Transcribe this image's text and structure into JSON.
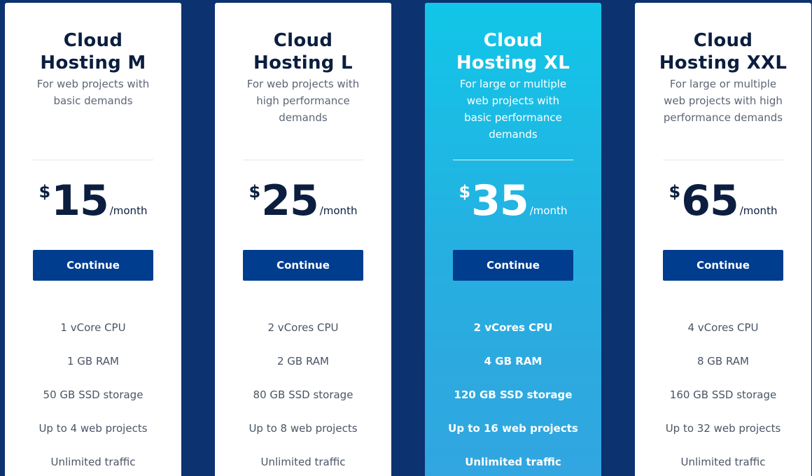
{
  "plans": [
    {
      "title": "Cloud\nHosting M",
      "subtitle": "For web projects with basic demands",
      "currency": "$",
      "price": "15",
      "period": "/month",
      "cta": "Continue",
      "features": [
        "1 vCore CPU",
        "1 GB RAM",
        "50 GB SSD storage",
        "Up to 4 web projects",
        "Unlimited traffic"
      ]
    },
    {
      "title": "Cloud\nHosting L",
      "subtitle": "For web projects with high performance demands",
      "currency": "$",
      "price": "25",
      "period": "/month",
      "cta": "Continue",
      "features": [
        "2 vCores CPU",
        "2 GB RAM",
        "80 GB SSD storage",
        "Up to 8 web projects",
        "Unlimited traffic"
      ]
    },
    {
      "title": "Cloud\nHosting XL",
      "subtitle": "For large or multiple web projects with basic performance demands",
      "currency": "$",
      "price": "35",
      "period": "/month",
      "cta": "Continue",
      "features": [
        "2 vCores CPU",
        "4 GB RAM",
        "120 GB SSD storage",
        "Up to 16 web projects",
        "Unlimited traffic"
      ]
    },
    {
      "title": "Cloud\nHosting XXL",
      "subtitle": "For large or multiple web projects with high performance demands",
      "currency": "$",
      "price": "65",
      "period": "/month",
      "cta": "Continue",
      "features": [
        "4 vCores CPU",
        "8 GB RAM",
        "160 GB SSD storage",
        "Up to 32 web projects",
        "Unlimited traffic"
      ]
    }
  ],
  "colors": {
    "page_background": "#0d3270",
    "button": "#003d8f",
    "featured_gradient_top": "#11c6e8",
    "featured_gradient_bottom": "#32a5e0",
    "title_text": "#0b1e3f"
  }
}
